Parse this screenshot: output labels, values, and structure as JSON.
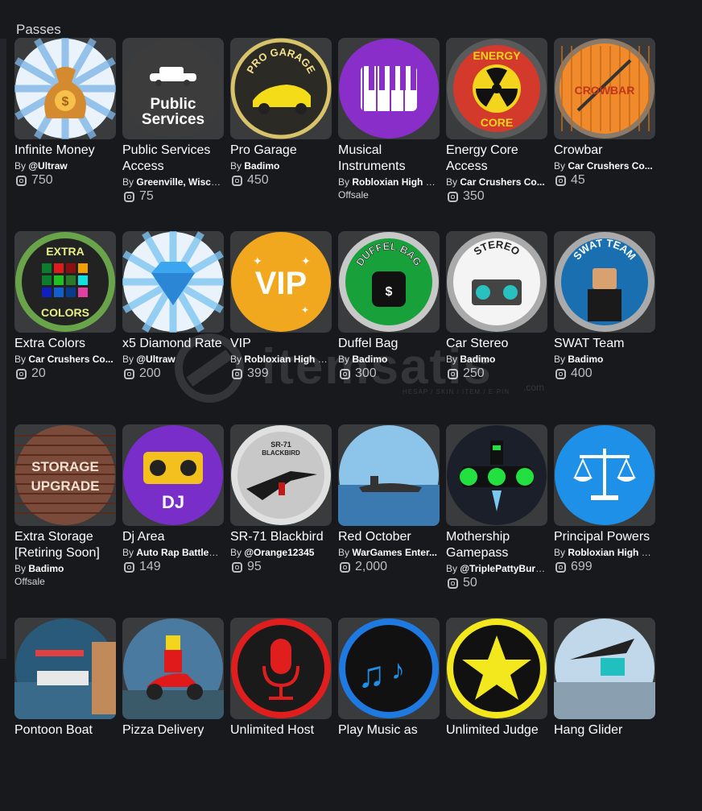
{
  "section": {
    "title": "Passes"
  },
  "by_prefix": "By",
  "offsale_label": "Offsale",
  "colors": {
    "background": "#18191d",
    "card_bg": "#393b3d",
    "text": "#ffffff",
    "muted": "#bdbec0"
  },
  "watermark": {
    "text": "itemsatis",
    "sub": "HESAP / SKIN / ITEM / E-PIN",
    "domain": ".com"
  },
  "passes": [
    {
      "name": "Infinite Money",
      "creator": "@Ultraw",
      "price": "750",
      "offsale": false,
      "icon": "money-bag-icon"
    },
    {
      "name": "Public Services Access",
      "creator": "Greenville, Wisco...",
      "price": "75",
      "offsale": false,
      "icon": "police-car-icon",
      "art_text_1": "Public",
      "art_text_2": "Services"
    },
    {
      "name": "Pro Garage",
      "creator": "Badimo",
      "price": "450",
      "offsale": false,
      "icon": "garage-car-icon",
      "art_text_1": "PRO GARAGE"
    },
    {
      "name": "Musical Instruments",
      "creator": "Robloxian High S...",
      "price": "",
      "offsale": true,
      "icon": "piano-keys-icon"
    },
    {
      "name": "Energy Core Access",
      "creator": "Car Crushers Co...",
      "price": "350",
      "offsale": false,
      "icon": "radiation-icon",
      "art_text_1": "ENERGY",
      "art_text_2": "CORE"
    },
    {
      "name": "Crowbar",
      "creator": "Car Crushers Co...",
      "price": "45",
      "offsale": false,
      "icon": "crowbar-icon",
      "art_text_1": "CROWBAR"
    },
    {
      "name": "Extra Colors",
      "creator": "Car Crushers Co...",
      "price": "20",
      "offsale": false,
      "icon": "color-palette-icon",
      "art_text_1": "EXTRA",
      "art_text_2": "COLORS"
    },
    {
      "name": "x5 Diamond Rate",
      "creator": "@Ultraw",
      "price": "200",
      "offsale": false,
      "icon": "diamond-icon"
    },
    {
      "name": "VIP",
      "creator": "Robloxian High S...",
      "price": "399",
      "offsale": false,
      "icon": "vip-badge-icon",
      "art_text_1": "VIP"
    },
    {
      "name": "Duffel Bag",
      "creator": "Badimo",
      "price": "300",
      "offsale": false,
      "icon": "duffel-bag-icon",
      "art_text_1": "DUFFEL BAG"
    },
    {
      "name": "Car Stereo",
      "creator": "Badimo",
      "price": "250",
      "offsale": false,
      "icon": "boombox-icon",
      "art_text_1": "STEREO"
    },
    {
      "name": "SWAT Team",
      "creator": "Badimo",
      "price": "400",
      "offsale": false,
      "icon": "swat-officer-icon",
      "art_text_1": "SWAT TEAM"
    },
    {
      "name": "Extra Storage [Retiring Soon]",
      "creator": "Badimo",
      "price": "",
      "offsale": true,
      "icon": "storage-upgrade-icon",
      "art_text_1": "STORAGE",
      "art_text_2": "UPGRADE"
    },
    {
      "name": "Dj Area",
      "creator": "Auto Rap Battles ...",
      "price": "149",
      "offsale": false,
      "icon": "dj-boombox-icon",
      "art_text_1": "DJ"
    },
    {
      "name": "SR-71 Blackbird",
      "creator": "@Orange12345",
      "price": "95",
      "offsale": false,
      "icon": "jet-plane-icon",
      "art_text_1": "SR-71",
      "art_text_2": "BLACKBIRD"
    },
    {
      "name": "Red October",
      "creator": "WarGames Enter...",
      "price": "2,000",
      "offsale": false,
      "icon": "submarine-icon"
    },
    {
      "name": "Mothership Gamepass",
      "creator": "@TriplePattyBurg...",
      "price": "50",
      "offsale": false,
      "icon": "mothership-icon"
    },
    {
      "name": "Principal Powers",
      "creator": "Robloxian High S...",
      "price": "699",
      "offsale": false,
      "icon": "scales-icon"
    },
    {
      "name": "Pontoon Boat",
      "creator": "",
      "price": "",
      "offsale": false,
      "icon": "pontoon-boat-icon"
    },
    {
      "name": "Pizza Delivery",
      "creator": "",
      "price": "",
      "offsale": false,
      "icon": "scooter-icon"
    },
    {
      "name": "Unlimited Host",
      "creator": "",
      "price": "",
      "offsale": false,
      "icon": "microphone-icon"
    },
    {
      "name": "Play Music as",
      "creator": "",
      "price": "",
      "offsale": false,
      "icon": "music-notes-icon"
    },
    {
      "name": "Unlimited Judge",
      "creator": "",
      "price": "",
      "offsale": false,
      "icon": "star-icon"
    },
    {
      "name": "Hang Glider",
      "creator": "",
      "price": "",
      "offsale": false,
      "icon": "hang-glider-icon"
    }
  ]
}
